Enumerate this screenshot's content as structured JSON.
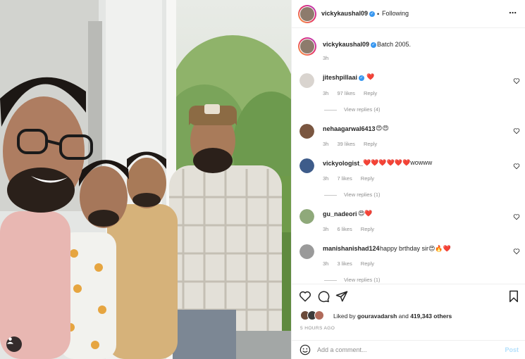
{
  "post": {
    "author": "vickykaushal09",
    "follow_status": "Following",
    "separator": "•",
    "more_icon": "⋯"
  },
  "caption": {
    "author": "vickykaushal09",
    "text": "Batch 2005.",
    "time": "3h"
  },
  "comments": [
    {
      "user": "jiteshpillaai",
      "verified": true,
      "text": "",
      "emoji": "❤️",
      "time": "3h",
      "likes": "97 likes",
      "reply": "Reply",
      "view_replies": "View replies (4)",
      "avatar_color": "#d9d4cf"
    },
    {
      "user": "nehaagarwal6413",
      "verified": false,
      "text": "",
      "emoji": "😍😍",
      "time": "3h",
      "likes": "39 likes",
      "reply": "Reply",
      "view_replies": "",
      "avatar_color": "#7a5640"
    },
    {
      "user": "vickyologist_",
      "verified": false,
      "text": "wowww",
      "emoji": "❤️❤️❤️❤️❤️❤️",
      "time": "3h",
      "likes": "7 likes",
      "reply": "Reply",
      "view_replies": "View replies (1)",
      "avatar_color": "#3e5c8a"
    },
    {
      "user": "gu_nadeori",
      "verified": false,
      "text": "",
      "emoji": "😍❤️",
      "time": "3h",
      "likes": "6 likes",
      "reply": "Reply",
      "view_replies": "",
      "avatar_color": "#8fa97a"
    },
    {
      "user": "manishanishad124",
      "verified": false,
      "text": "happy brthday sir",
      "emoji": "😍🔥❤️",
      "time": "3h",
      "likes": "3 likes",
      "reply": "Reply",
      "view_replies": "View replies (1)",
      "avatar_color": "#9a9a9a"
    }
  ],
  "likes": {
    "prefix": "Liked by",
    "user": "gouravadarsh",
    "and": "and",
    "others": "419,343 others"
  },
  "time_ago": "5 HOURS AGO",
  "comment_box": {
    "placeholder": "Add a comment...",
    "post_label": "Post"
  },
  "colors": {
    "link_blue": "#3897f0",
    "post_disabled": "#b2dffc",
    "verified_badge": "#3897f0"
  }
}
